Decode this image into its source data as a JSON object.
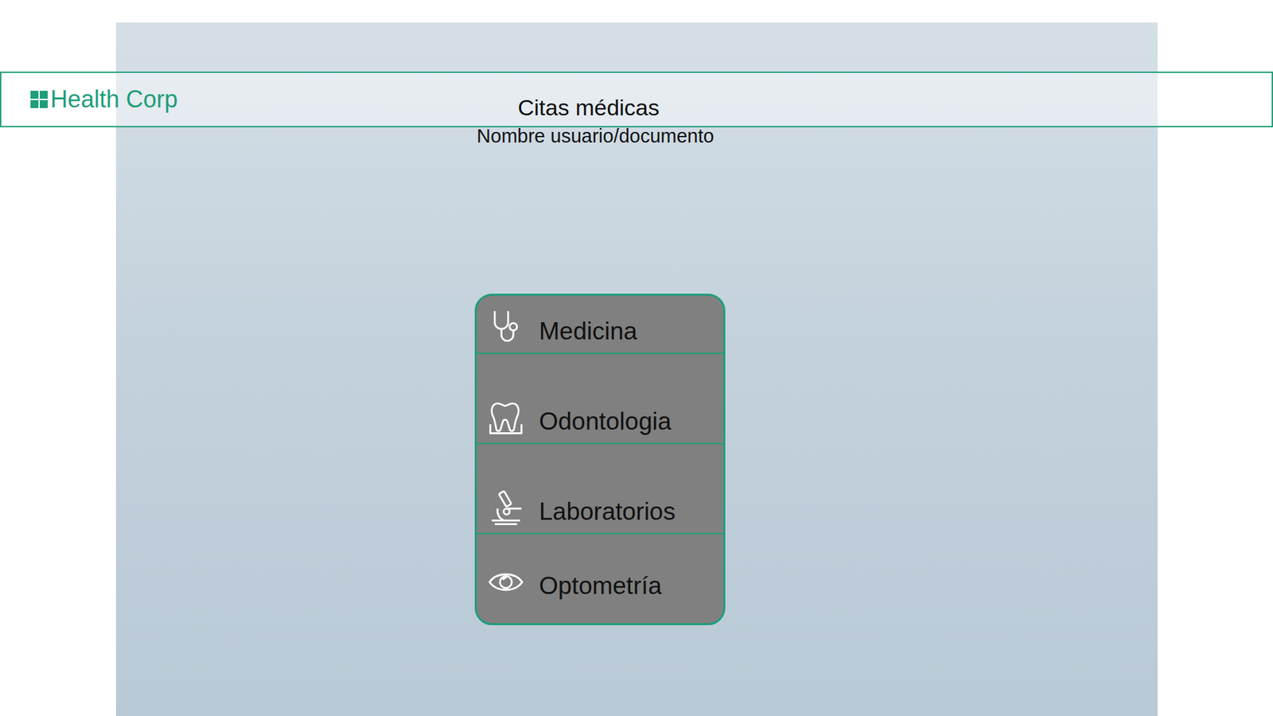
{
  "header": {
    "logo": "Health Corp",
    "title": "Citas médicas",
    "subtitle": "Nombre usuario/documento"
  },
  "menu": [
    {
      "label": "Medicina"
    },
    {
      "label": "Odontologia"
    },
    {
      "label": "Laboratorios"
    },
    {
      "label": "Optometría"
    }
  ]
}
